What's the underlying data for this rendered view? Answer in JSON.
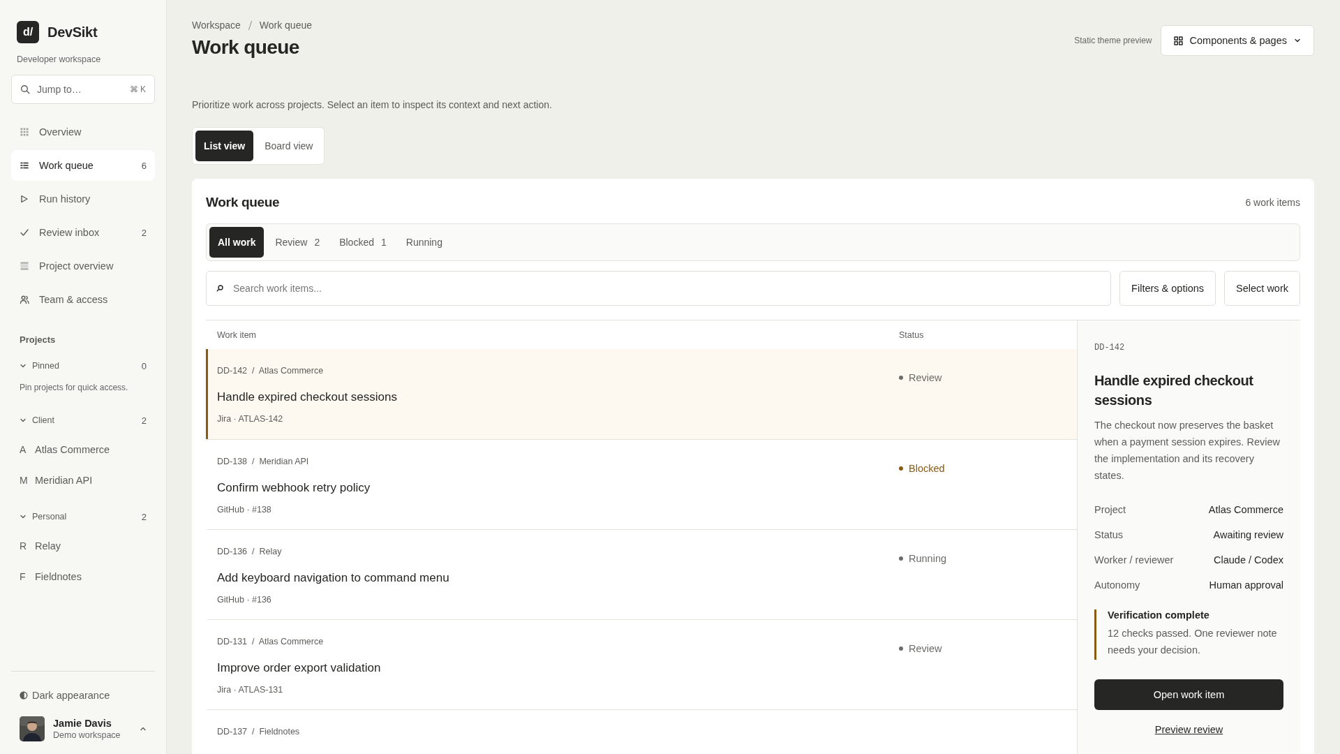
{
  "brand": {
    "logo": "d/",
    "name": "DevSikt",
    "subtitle": "Developer workspace"
  },
  "jump": {
    "placeholder": "Jump to…",
    "shortcut": "⌘ K"
  },
  "nav": [
    {
      "label": "Overview",
      "selected": false
    },
    {
      "label": "Work queue",
      "count": "6",
      "selected": true
    },
    {
      "label": "Run history",
      "selected": false
    },
    {
      "label": "Review inbox",
      "count": "2",
      "selected": false
    },
    {
      "label": "Project overview",
      "selected": false
    },
    {
      "label": "Team & access",
      "selected": false
    }
  ],
  "projects": {
    "heading": "Projects",
    "groups": [
      {
        "label": "Pinned",
        "count": "0",
        "expanded": true,
        "empty_text": "Pin projects for quick access."
      },
      {
        "label": "Client",
        "count": "2",
        "expanded": true,
        "children": [
          {
            "initial": "A",
            "label": "Atlas Commerce"
          },
          {
            "initial": "M",
            "label": "Meridian API"
          }
        ]
      },
      {
        "label": "Personal",
        "count": "2",
        "expanded": true,
        "children": [
          {
            "initial": "R",
            "label": "Relay"
          },
          {
            "initial": "F",
            "label": "Fieldnotes"
          }
        ]
      }
    ]
  },
  "appearance": {
    "label": "Dark appearance"
  },
  "user": {
    "name": "Jamie Davis",
    "workspace": "Demo workspace"
  },
  "header": {
    "breadcrumb": [
      "Workspace",
      "Work queue"
    ],
    "title": "Work queue",
    "theme_label": "Static theme preview",
    "menu_button": "Components & pages",
    "description": "Prioritize work across projects. Select an item to inspect its context and next action."
  },
  "views": [
    {
      "label": "List view",
      "selected": true
    },
    {
      "label": "Board view",
      "selected": false
    }
  ],
  "card": {
    "title": "Work queue",
    "count": "6 work items",
    "filters": [
      {
        "label": "All work",
        "selected": true
      },
      {
        "label": "Review",
        "count": "2",
        "selected": false
      },
      {
        "label": "Blocked",
        "count": "1",
        "selected": false
      },
      {
        "label": "Running",
        "selected": false
      }
    ],
    "search": {
      "placeholder": "Search work items..."
    },
    "buttons": [
      "Filters & options",
      "Select work"
    ],
    "columns": [
      "Work item",
      "Status"
    ],
    "rows": [
      {
        "meta": "DD-142  /  Atlas Commerce",
        "title": "Handle expired checkout sessions",
        "source": "Jira · ATLAS-142",
        "status": "Review",
        "color": "#6b6b68",
        "selected": true
      },
      {
        "meta": "DD-138  /  Meridian API",
        "title": "Confirm webhook retry policy",
        "source": "GitHub · #138",
        "status": "Blocked",
        "color": "#8a5a12",
        "selected": false
      },
      {
        "meta": "DD-136  /  Relay",
        "title": "Add keyboard navigation to command menu",
        "source": "GitHub · #136",
        "status": "Running",
        "color": "#6b6b68",
        "selected": false
      },
      {
        "meta": "DD-131  /  Atlas Commerce",
        "title": "Improve order export validation",
        "source": "Jira · ATLAS-131",
        "status": "Review",
        "color": "#6b6b68",
        "selected": false
      },
      {
        "meta": "DD-137  /  Fieldnotes",
        "selected": false
      }
    ]
  },
  "detail": {
    "id": "DD-142",
    "title": "Handle expired checkout sessions",
    "description": "The checkout now preserves the basket when a payment session expires. Review the implementation and its recovery states.",
    "fields": [
      {
        "label": "Project",
        "value": "Atlas Commerce"
      },
      {
        "label": "Status",
        "value": "Awaiting review"
      },
      {
        "label": "Worker / reviewer",
        "value": "Claude / Codex"
      },
      {
        "label": "Autonomy",
        "value": "Human approval"
      }
    ],
    "note": {
      "title": "Verification complete",
      "text": "12 checks passed. One reviewer note needs your decision."
    },
    "primary": "Open work item",
    "link": "Preview review"
  }
}
